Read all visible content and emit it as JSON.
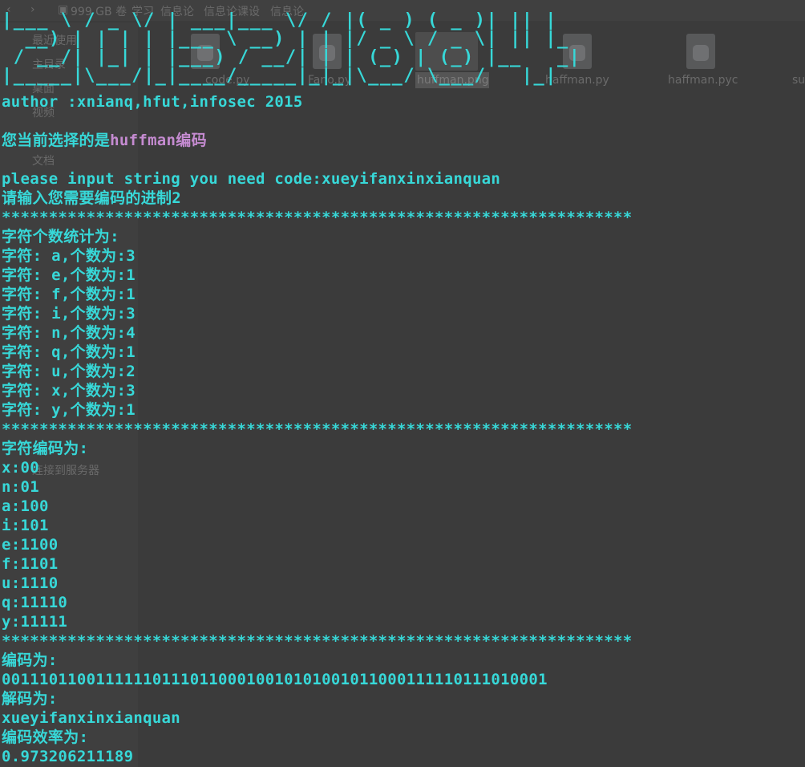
{
  "background_window": {
    "path_crumbs": [
      "999 GB 卷",
      "学习",
      "信息论",
      "信息论课设",
      "信息论"
    ],
    "sidebar_items": [
      "最近使用",
      "主目录",
      "桌面",
      "视频",
      "文档",
      "连接到服务器"
    ],
    "files": [
      {
        "name": "code.py"
      },
      {
        "name": "Fano.py"
      },
      {
        "name": "huffman.png"
      },
      {
        "name": "haffman.py"
      },
      {
        "name": "haffman.pyc"
      },
      {
        "name": "su"
      }
    ]
  },
  "terminal": {
    "banner_lines": [
      "|___ \\ / _ \\/ | ___|___ \\/ / |( _ ) ( _ )| || |",
      "  __) | | | | |___ \\ __) | | |/ _ \\ / _ \\| || |_",
      " / __/| |_| | |___) / __/| | | (_) | (_) |__   _|",
      "|_____|\\___/|_|____/_____|_|_|\\___/ \\___/   |_|"
    ],
    "author_line": "author :xnianq,hfut,infosec 2015",
    "selection_prefix": "您当前选择的是",
    "selection_value": "huffman编码",
    "input_prompt_line": "please input string you need code:xueyifanxinxianquan",
    "base_prompt_line": "请输入您需要编码的进制2",
    "separator": "*******************************************************************",
    "count_header": "字符个数统计为:",
    "char_counts": [
      "字符: a,个数为:3",
      "字符: e,个数为:1",
      "字符: f,个数为:1",
      "字符: i,个数为:3",
      "字符: n,个数为:4",
      "字符: q,个数为:1",
      "字符: u,个数为:2",
      "字符: x,个数为:3",
      "字符: y,个数为:1"
    ],
    "code_header": "字符编码为:",
    "codes": [
      "x:00",
      "n:01",
      "a:100",
      "i:101",
      "e:1100",
      "f:1101",
      "u:1110",
      "q:11110",
      "y:11111"
    ],
    "encoded_header": "编码为:",
    "encoded_value": "0011101100111111011101100010010101001011000111110111010001",
    "decoded_header": "解码为:",
    "decoded_value": "xueyifanxinxianquan",
    "efficiency_header": "编码效率为:",
    "efficiency_value": "0.973206211189"
  }
}
